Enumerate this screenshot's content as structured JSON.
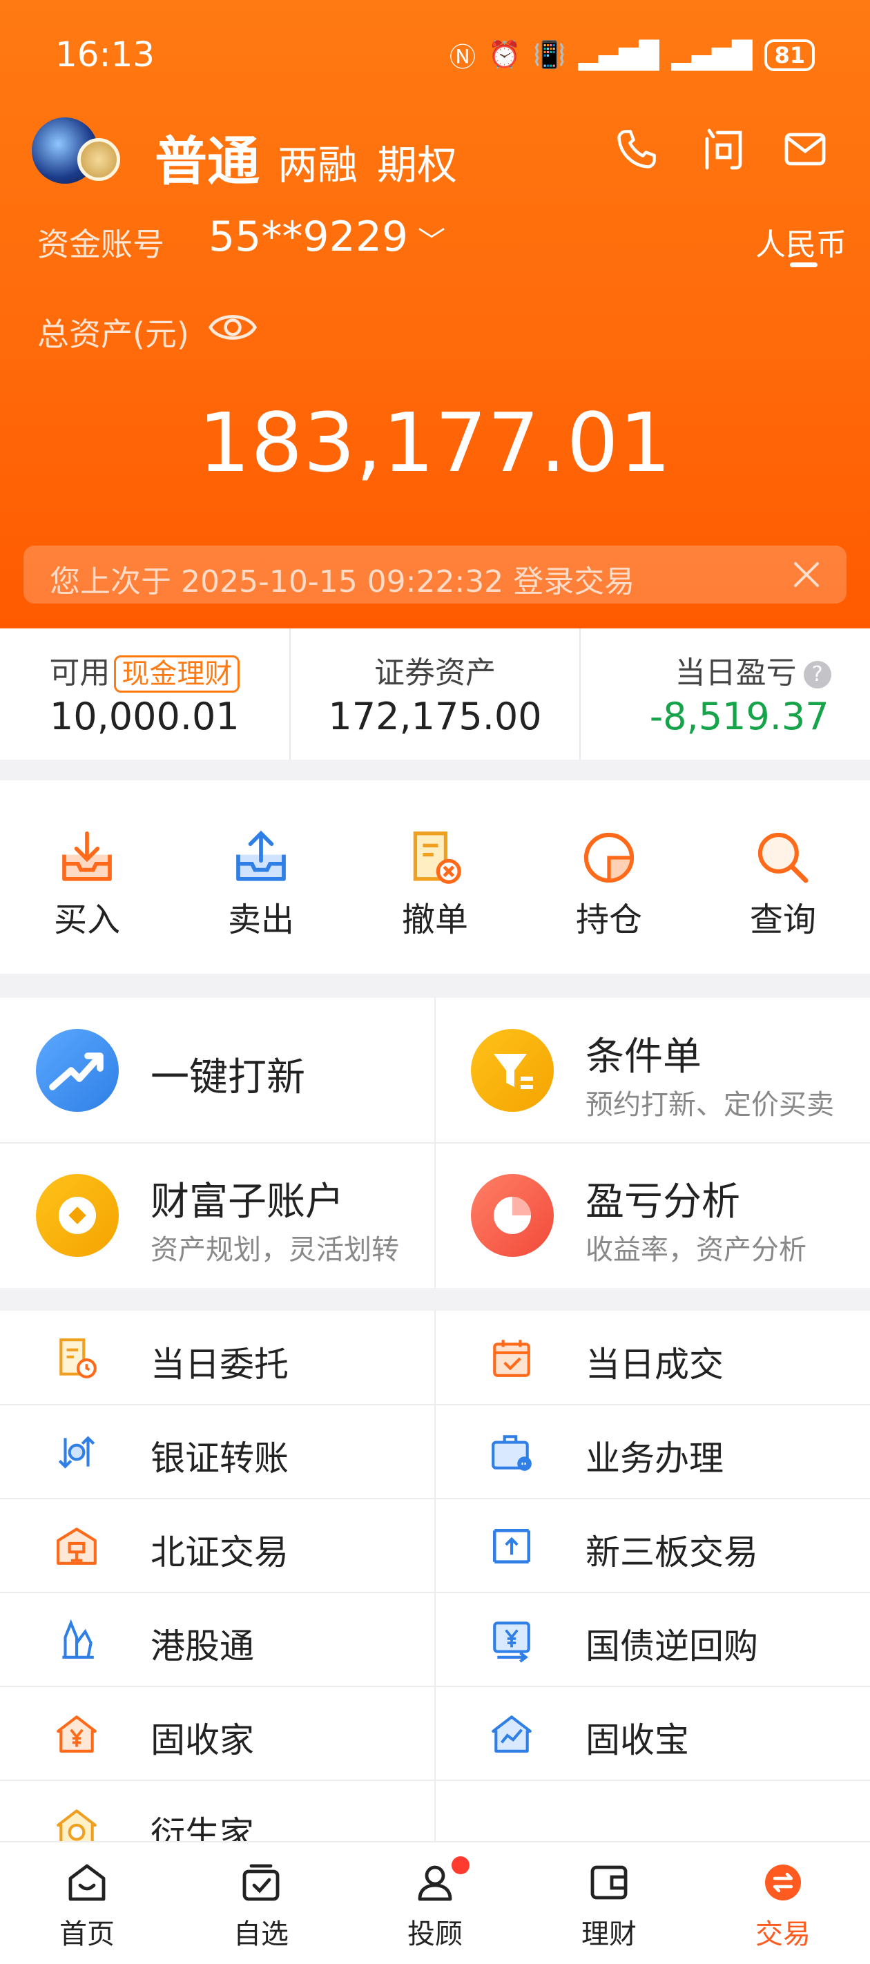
{
  "status_bar": {
    "time": "16:13",
    "battery": "81"
  },
  "header": {
    "tabs": [
      "普通",
      "两融",
      "期权"
    ],
    "account_label": "资金账号",
    "account_number": "55**9229",
    "currency": "人民币",
    "total_assets_label": "总资产(元)",
    "total_assets": "183,177.01",
    "notice": "您上次于 2025-10-15  09:22:32 登录交易"
  },
  "summary": [
    {
      "label": "可用",
      "tag": "现金理财",
      "value": "10,000.01"
    },
    {
      "label": "证券资产",
      "value": "172,175.00"
    },
    {
      "label": "当日盈亏",
      "value": "-8,519.37"
    }
  ],
  "actions": [
    "买入",
    "卖出",
    "撤单",
    "持仓",
    "查询"
  ],
  "features": [
    {
      "title": "一键打新",
      "subtitle": ""
    },
    {
      "title": "条件单",
      "subtitle": "预约打新、定价买卖"
    },
    {
      "title": "财富子账户",
      "subtitle": "资产规划，灵活划转"
    },
    {
      "title": "盈亏分析",
      "subtitle": "收益率，资产分析"
    }
  ],
  "menu": [
    "当日委托",
    "当日成交",
    "银证转账",
    "业务办理",
    "北证交易",
    "新三板交易",
    "港股通",
    "国债逆回购",
    "固收家",
    "固收宝",
    "衍生家"
  ],
  "tabbar": [
    "首页",
    "自选",
    "投顾",
    "理财",
    "交易"
  ],
  "colors": {
    "accent": "#ff6a0a",
    "loss": "#16a34a",
    "active_tab": "#ff5a1f"
  }
}
